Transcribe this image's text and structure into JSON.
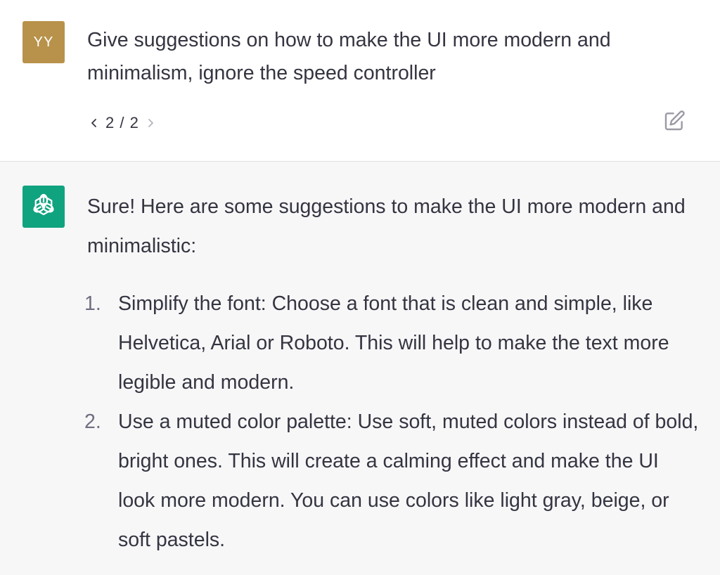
{
  "user": {
    "avatar_initials": "YY",
    "avatar_color": "#b8924a",
    "message": "Give suggestions on how to make the UI more modern and minimalism, ignore the speed controller",
    "pager": {
      "prev_icon": "chevron-left-icon",
      "current": "2 / 2",
      "next_icon": "chevron-right-icon"
    },
    "edit_icon": "edit-icon"
  },
  "assistant": {
    "avatar_icon": "openai-logo-icon",
    "avatar_color": "#10a37f",
    "intro": "Sure! Here are some suggestions to make the UI more modern and minimalistic:",
    "items": [
      {
        "number": "1.",
        "text": "Simplify the font: Choose a font that is clean and simple, like Helvetica, Arial or Roboto. This will help to make the text more legible and modern."
      },
      {
        "number": "2.",
        "text": "Use a muted color palette: Use soft, muted colors instead of bold, bright ones. This will create a calming effect and make the UI look more modern. You can use colors like light gray, beige, or soft pastels."
      }
    ]
  }
}
